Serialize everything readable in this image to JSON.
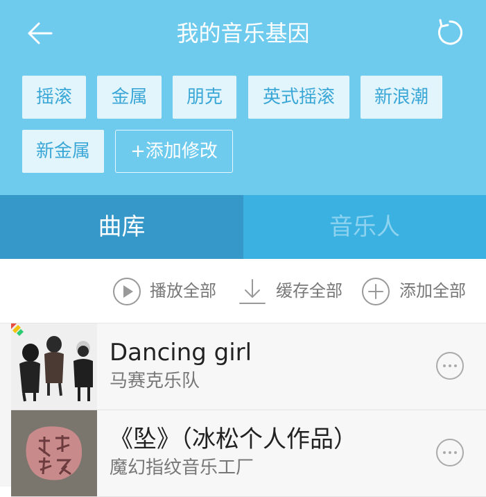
{
  "header": {
    "title": "我的音乐基因",
    "back_icon": "arrow-left-icon",
    "refresh_icon": "refresh-icon",
    "background_color": "#6fcbee"
  },
  "tags": {
    "items": [
      "摇滚",
      "金属",
      "朋克",
      "英式摇滚",
      "新浪潮",
      "新金属"
    ],
    "add_label": "+添加修改"
  },
  "tabs": {
    "library": "曲库",
    "artists": "音乐人",
    "active": "曲库"
  },
  "actions": {
    "play_all": "播放全部",
    "cache_all": "缓存全部",
    "add_all": "添加全部"
  },
  "songs": [
    {
      "title": "Dancing girl",
      "artist": "马赛克乐队"
    },
    {
      "title": "《坠》（冰松个人作品）",
      "artist": "魔幻指纹音乐工厂"
    }
  ],
  "colors": {
    "header_bg": "#6fcbee",
    "tab_active_bg": "#3698c9",
    "tab_inactive_bg": "#3ab1e1",
    "tag_bg": "#e3f5fc",
    "tag_text": "#3aa7d7"
  }
}
